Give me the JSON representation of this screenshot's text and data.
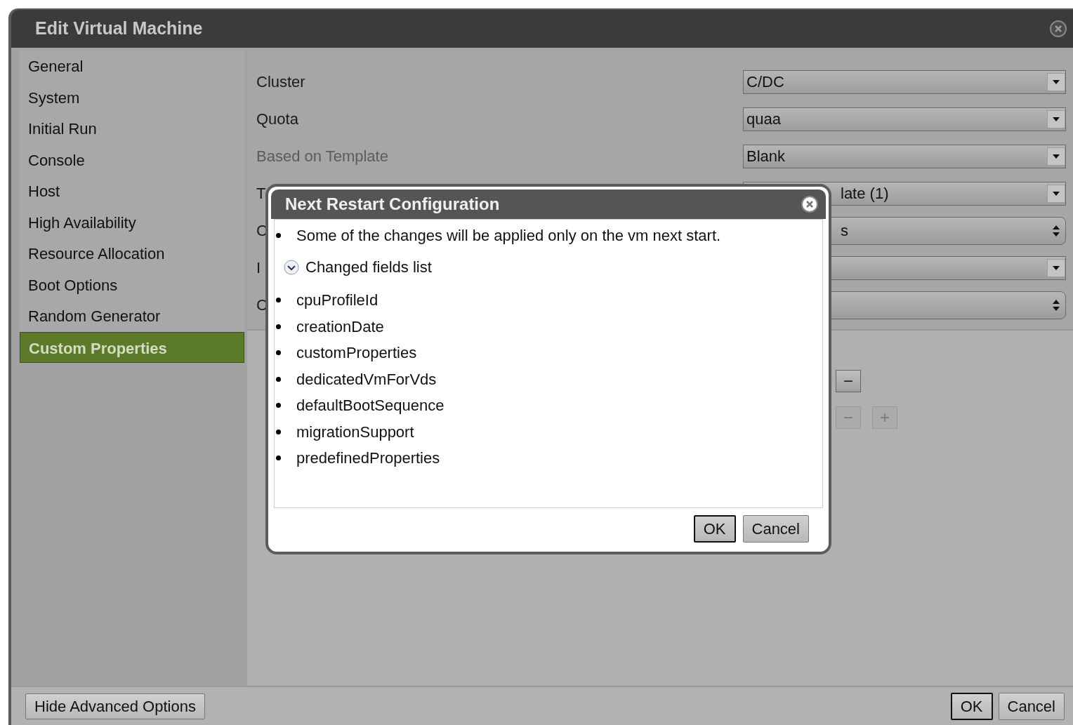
{
  "window": {
    "title": "Edit Virtual Machine"
  },
  "sidebar": {
    "items": [
      {
        "label": "General",
        "selected": false
      },
      {
        "label": "System",
        "selected": false
      },
      {
        "label": "Initial Run",
        "selected": false
      },
      {
        "label": "Console",
        "selected": false
      },
      {
        "label": "Host",
        "selected": false
      },
      {
        "label": "High Availability",
        "selected": false
      },
      {
        "label": "Resource Allocation",
        "selected": false
      },
      {
        "label": "Boot Options",
        "selected": false
      },
      {
        "label": "Random Generator",
        "selected": false
      },
      {
        "label": "Custom Properties",
        "selected": true
      }
    ]
  },
  "fields": [
    {
      "label": "Cluster",
      "value": "C/DC",
      "kind": "dropdown",
      "disabled": false,
      "covered": false
    },
    {
      "label": "Quota",
      "value": "quaa",
      "kind": "dropdown",
      "disabled": false,
      "covered": false
    },
    {
      "label": "Based on Template",
      "value": "Blank",
      "kind": "dropdown",
      "disabled": true,
      "covered": false
    },
    {
      "label": "T",
      "value": "late (1)",
      "kind": "dropdown",
      "disabled": false,
      "covered": true
    },
    {
      "label": "C",
      "value": "s",
      "kind": "spinner",
      "disabled": false,
      "covered": true
    },
    {
      "label": "I",
      "kind": "dropdown",
      "disabled": false
    },
    {
      "label": "C",
      "kind": "spinner",
      "disabled": false
    }
  ],
  "property_rows": [
    {
      "buttons": [
        {
          "glyph": "−",
          "disabled": false
        }
      ]
    },
    {
      "buttons": [
        {
          "glyph": "−",
          "disabled": true
        },
        {
          "glyph": "+",
          "disabled": true
        }
      ]
    }
  ],
  "modal": {
    "title": "Next Restart Configuration",
    "message": "Some of the changes will be applied only on the vm next start.",
    "expander": {
      "label": "Changed fields list",
      "expanded": true
    },
    "changed_fields": [
      "cpuProfileId",
      "creationDate",
      "customProperties",
      "dedicatedVmForVds",
      "defaultBootSequence",
      "migrationSupport",
      "predefinedProperties"
    ],
    "buttons": [
      {
        "label": "OK",
        "primary": true
      },
      {
        "label": "Cancel",
        "primary": false
      }
    ]
  },
  "footer": {
    "left_button": "Hide Advanced Options",
    "buttons": [
      {
        "label": "OK",
        "primary": true
      },
      {
        "label": "Cancel",
        "primary": false
      }
    ]
  }
}
